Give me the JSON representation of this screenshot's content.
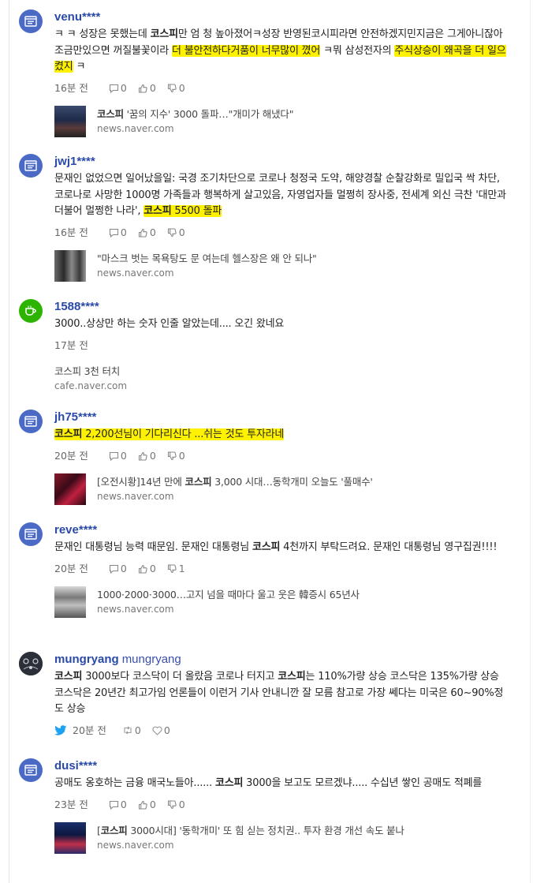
{
  "posts": [
    {
      "username": "venu****",
      "text_parts": [
        "ㅋ ㅋ 성장은 못했는데 ",
        "코스피",
        "만 엄 청 높아졌어ㅋ성장 반영된코시피라면 안전하겠지민지금은 그게아니잖아 조금만있으면 꺼질불꽃이라 ",
        "더 불안전하다거품이 너무많이 꼈어",
        " ㅋ뭐 삼성전자의 ",
        "주식상승이 왜곡을 더 일으켰지",
        " ㅋ"
      ],
      "time": "16분 전",
      "replies": "0",
      "likes": "0",
      "dislikes": "0",
      "link_title_parts": [
        "코스피",
        " '꿈의 지수' 3000 돌파…\"개미가 해냈다\""
      ],
      "link_domain": "news.naver.com"
    },
    {
      "username": "jwj1****",
      "text_parts": [
        "문재인 없었으면 일어났을일: 국경 조기차단으로 코로나 청정국 도약, 해양경찰 순찰강화로 밀입국 싹 차단, 코로나로 사망한 1000명 가족들과 행복하게 살고있음, 자영업자들 멀쩡히 장사중, 전세계 외신 극찬 '대만과 더불어 멀쩡한 나라', ",
        "코스피",
        " 5500 돌파"
      ],
      "time": "16분 전",
      "replies": "0",
      "likes": "0",
      "dislikes": "0",
      "link_title_parts": [
        "",
        "\"마스크 벗는 목욕탕도 문 여는데 헬스장은 왜 안 되나\""
      ],
      "link_domain": "news.naver.com"
    },
    {
      "username": "1588****",
      "text_parts": [
        "3000..상상만 하는 숫자 인줄 알았는데.... 오긴 왔네요"
      ],
      "time": "17분 전",
      "link_title_parts": [
        "코스피",
        " 3천 터치"
      ],
      "link_domain": "cafe.naver.com"
    },
    {
      "username": "jh75****",
      "text_parts": [
        "코스피",
        " 2,200선님이 기다리신다 ...쉬는 것도 투자라네"
      ],
      "time": "20분 전",
      "replies": "0",
      "likes": "0",
      "dislikes": "0",
      "link_title_parts": [
        "[오전시황]14년 만에 ",
        "코스피",
        " 3,000 시대…동학개미 오늘도 '풀매수'"
      ],
      "link_domain": "news.naver.com"
    },
    {
      "username": "reve****",
      "text_parts": [
        "문재인 대통령님 능력 때문임. 문재인 대통령님 ",
        "코스피",
        " 4천까지 부탁드려요. 문재인 대통령님 영구집권!!!!"
      ],
      "time": "20분 전",
      "replies": "0",
      "likes": "0",
      "dislikes": "1",
      "link_title_parts": [
        "",
        "1000·2000·3000…고지 넘을 때마다 울고 웃은 韓증시 65년사"
      ],
      "link_domain": "news.naver.com"
    },
    {
      "username": "mungryang",
      "display_name": "mungryang",
      "text_parts": [
        "코스피",
        " 3000보다 코스닥이 더 올랐음 코로나 터지고 ",
        "코스피",
        "는 110%가량 상승 코스닥은 135%가량 상승 코스닥은 20년간 최고가임 언론들이 이런거 기사 안내니깐 잘 모름 참고로 가장 쎄다는 미국은 60~90%정도 상승"
      ],
      "time": "20분 전",
      "retweets": "0",
      "hearts": "0"
    },
    {
      "username": "dusi****",
      "text_parts": [
        "공매도 옹호하는 금융 매국노들아...... ",
        "코스피",
        " 3000을 보고도 모르겠냐..... 수십년 쌓인 공매도 적폐를"
      ],
      "time": "23분 전",
      "replies": "0",
      "likes": "0",
      "dislikes": "0",
      "link_title_parts": [
        "[",
        "코스피",
        " 3000시대] '동학개미' 또 힘 싣는 정치권.. 투자 환경 개선 속도 붙나"
      ],
      "link_domain": "news.naver.com"
    }
  ],
  "colors": {
    "username": "#2a4aa8",
    "highlight": "#fff200",
    "blog_avatar": "#4a6ac6",
    "cafe_avatar": "#2db400",
    "twitter": "#1da1f2"
  },
  "icons": {
    "blog": "blog-icon",
    "cafe": "cafe-cup-icon",
    "reply": "comment-icon",
    "like": "thumb-up-icon",
    "dislike": "thumb-down-icon",
    "twitter": "twitter-bird-icon",
    "retweet": "retweet-icon",
    "heart": "heart-icon"
  }
}
